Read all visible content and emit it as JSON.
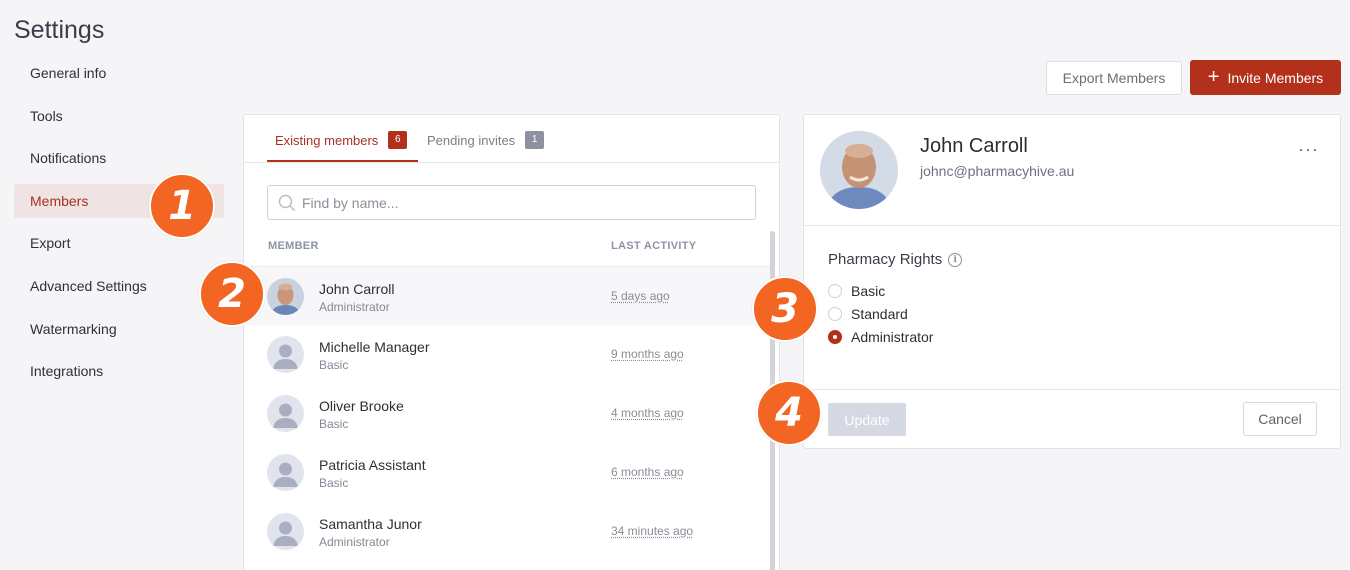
{
  "page": {
    "title": "Settings"
  },
  "sidebar": {
    "items": [
      {
        "label": "General info"
      },
      {
        "label": "Tools"
      },
      {
        "label": "Notifications"
      },
      {
        "label": "Members",
        "active": true
      },
      {
        "label": "Export"
      },
      {
        "label": "Advanced Settings"
      },
      {
        "label": "Watermarking"
      },
      {
        "label": "Integrations"
      }
    ]
  },
  "toolbar": {
    "export_label": "Export Members",
    "invite_label": "Invite Members"
  },
  "members": {
    "tabs": [
      {
        "label": "Existing members",
        "count": "6"
      },
      {
        "label": "Pending invites",
        "count": "1"
      }
    ],
    "search_placeholder": "Find by name...",
    "columns": {
      "member": "MEMBER",
      "activity": "LAST ACTIVITY"
    },
    "rows": [
      {
        "name": "John Carroll",
        "role": "Administrator",
        "activity": "5 days ago",
        "selected": true
      },
      {
        "name": "Michelle Manager",
        "role": "Basic",
        "activity": "9 months ago"
      },
      {
        "name": "Oliver Brooke",
        "role": "Basic",
        "activity": "4 months ago"
      },
      {
        "name": "Patricia Assistant",
        "role": "Basic",
        "activity": "6 months ago"
      },
      {
        "name": "Samantha Junor",
        "role": "Administrator",
        "activity": "34 minutes ago"
      }
    ]
  },
  "detail": {
    "name": "John Carroll",
    "email": "johnc@pharmacyhive.au",
    "more_label": "···",
    "rights_label": "Pharmacy Rights",
    "info_glyph": "i",
    "options": [
      {
        "label": "Basic",
        "checked": false
      },
      {
        "label": "Standard",
        "checked": false
      },
      {
        "label": "Administrator",
        "checked": true
      }
    ],
    "update_label": "Update",
    "cancel_label": "Cancel"
  },
  "callouts": [
    "1",
    "2",
    "3",
    "4"
  ],
  "colors": {
    "accent": "#b3311b",
    "callout": "#f26522",
    "active_bg": "#f0e3e3"
  }
}
